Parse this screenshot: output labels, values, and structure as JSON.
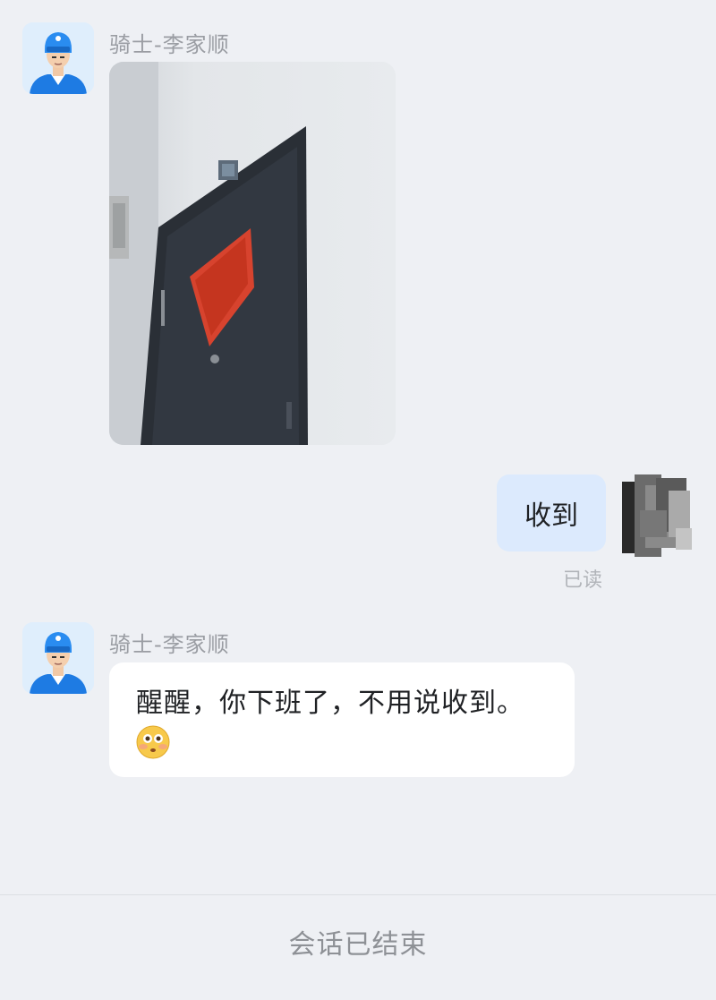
{
  "messages": [
    {
      "sender": "骑士-李家顺",
      "type": "image",
      "avatar_icon": "delivery-rider-avatar"
    },
    {
      "sender": "self",
      "type": "text",
      "text": "收到",
      "status": "已读",
      "avatar_icon": "blurred-user-avatar"
    },
    {
      "sender": "骑士-李家顺",
      "type": "text",
      "text": "醒醒，你下班了，不用说收到。",
      "emoji": "flushed-face-emoji",
      "avatar_icon": "delivery-rider-avatar"
    }
  ],
  "footer": {
    "text": "会话已结束"
  },
  "colors": {
    "background": "#eef0f4",
    "my_bubble": "#dceafd",
    "their_bubble": "#ffffff",
    "rider_jacket": "#1e7be3"
  }
}
